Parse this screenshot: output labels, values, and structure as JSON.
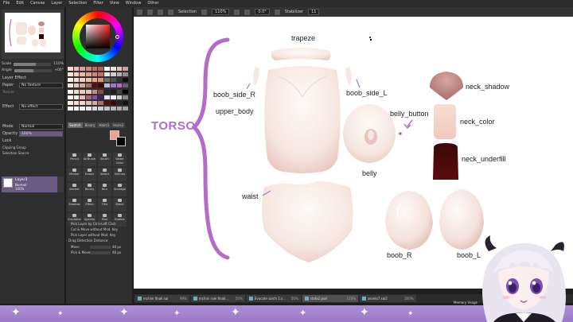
{
  "menubar": [
    "File",
    "Edit",
    "Canvas",
    "Layer",
    "Selection",
    "Filter",
    "View",
    "Window",
    "Other"
  ],
  "toolbar": {
    "selection_label": "Selection",
    "zoom": "110%",
    "rotation": "0.0°",
    "stabilizer_label": "Stabilizer",
    "stabilizer_value": "11"
  },
  "navigator": {
    "scale_label": "Scale",
    "scale_value": "110%",
    "angle_label": "Angle",
    "angle_value": "+00°"
  },
  "layer_panel": {
    "section": "Layer Effect",
    "paper_label": "Paper",
    "paper_value": "No Texture",
    "texture_label": "Texture",
    "effect_label": "Effect",
    "effect_value": "No effect",
    "mode_label": "Mode",
    "mode_value": "Normal",
    "opacity_label": "Opacity",
    "opacity_value": "100%",
    "lock_label": "Lock",
    "clipping_group": "Clipping Group",
    "selection_source": "Selection Source",
    "layer_name": "Layer3",
    "layer_mode": "Normal",
    "layer_opacity": "100%"
  },
  "color_tabs": [
    "Swatch",
    "Binary",
    "Hairs1",
    "Hairs2"
  ],
  "colors": {
    "foreground": "#f0a090",
    "background": "#000000",
    "accent": "#b46cc8"
  },
  "tools": [
    "Pencil",
    "AirBrush",
    "Brush",
    "Water Color",
    "Marker",
    "Eraser",
    "Select",
    "SelEras",
    "Bucket",
    "Binary",
    "Blur",
    "Smudge",
    "Shadow",
    "Effect",
    "Thin",
    "Bleed",
    "Gradation",
    "Sparkle",
    "Mist",
    "Bubble"
  ],
  "tool_options": [
    "Pick Layer by Ctrl+Left Click",
    "Cut & Move without Mod. Key",
    "Pick Layer without Mod. Key",
    "Drag Detection Distance:",
    "Move",
    "Pick & Move"
  ],
  "tool_option_values": [
    "48 px",
    "48 px"
  ],
  "canvas_labels": {
    "torso": "TORSO",
    "trapeze": "trapeze",
    "boob_side_r": "boob_side_R",
    "boob_side_l": "boob_side_L",
    "upper_body": "upper_body",
    "belly_button": "belly_button",
    "belly": "belly",
    "neck_shadow": "neck_shadow",
    "neck_color": "neck_color",
    "neck_underfill": "neck_underfill",
    "waist": "waist",
    "boob_r": "boob_R",
    "boob_l": "boob_L"
  },
  "file_tabs": [
    {
      "name": "mchini finall.sai",
      "pct": "99%"
    },
    {
      "name": "mchini rale finall...",
      "pct": "50%"
    },
    {
      "name": "Evocate sarch 1.s...",
      "pct": "50%"
    },
    {
      "name": "stafa2.psd",
      "pct": "110%",
      "active": true
    },
    {
      "name": "assets7.sai2",
      "pct": "200%"
    }
  ],
  "memory_label": "Memory Usage",
  "icons": [
    "cursor-icon",
    "move-icon",
    "zoom-icon",
    "rotate-icon",
    "eye-icon",
    "lock-icon",
    "sparkle-icon"
  ]
}
